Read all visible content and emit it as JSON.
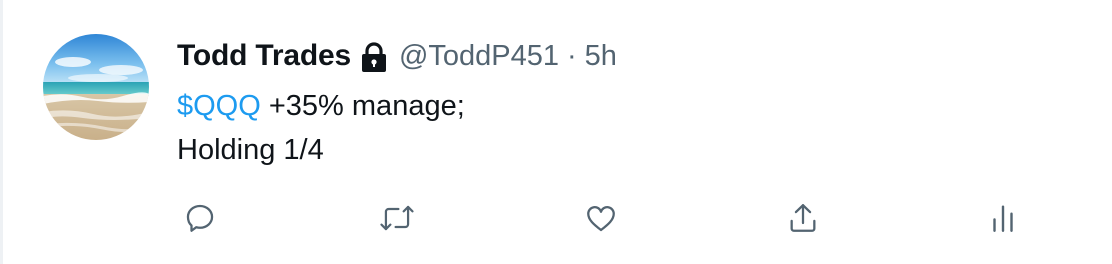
{
  "tweet": {
    "display_name": "Todd Trades",
    "handle": "@ToddP451",
    "separator": "·",
    "time": "5h",
    "text": {
      "cashtag": "$QQQ",
      "line1_rest": " +35% manage;",
      "line2": "Holding 1/4"
    },
    "protected_icon": "lock-icon"
  },
  "actions": [
    {
      "name": "reply",
      "icon": "reply-icon"
    },
    {
      "name": "retweet",
      "icon": "retweet-icon"
    },
    {
      "name": "like",
      "icon": "heart-icon"
    },
    {
      "name": "share",
      "icon": "share-icon"
    },
    {
      "name": "analytics",
      "icon": "analytics-icon"
    }
  ],
  "colors": {
    "link": "#1d9bf0",
    "text": "#0f1419",
    "secondary": "#536471"
  }
}
